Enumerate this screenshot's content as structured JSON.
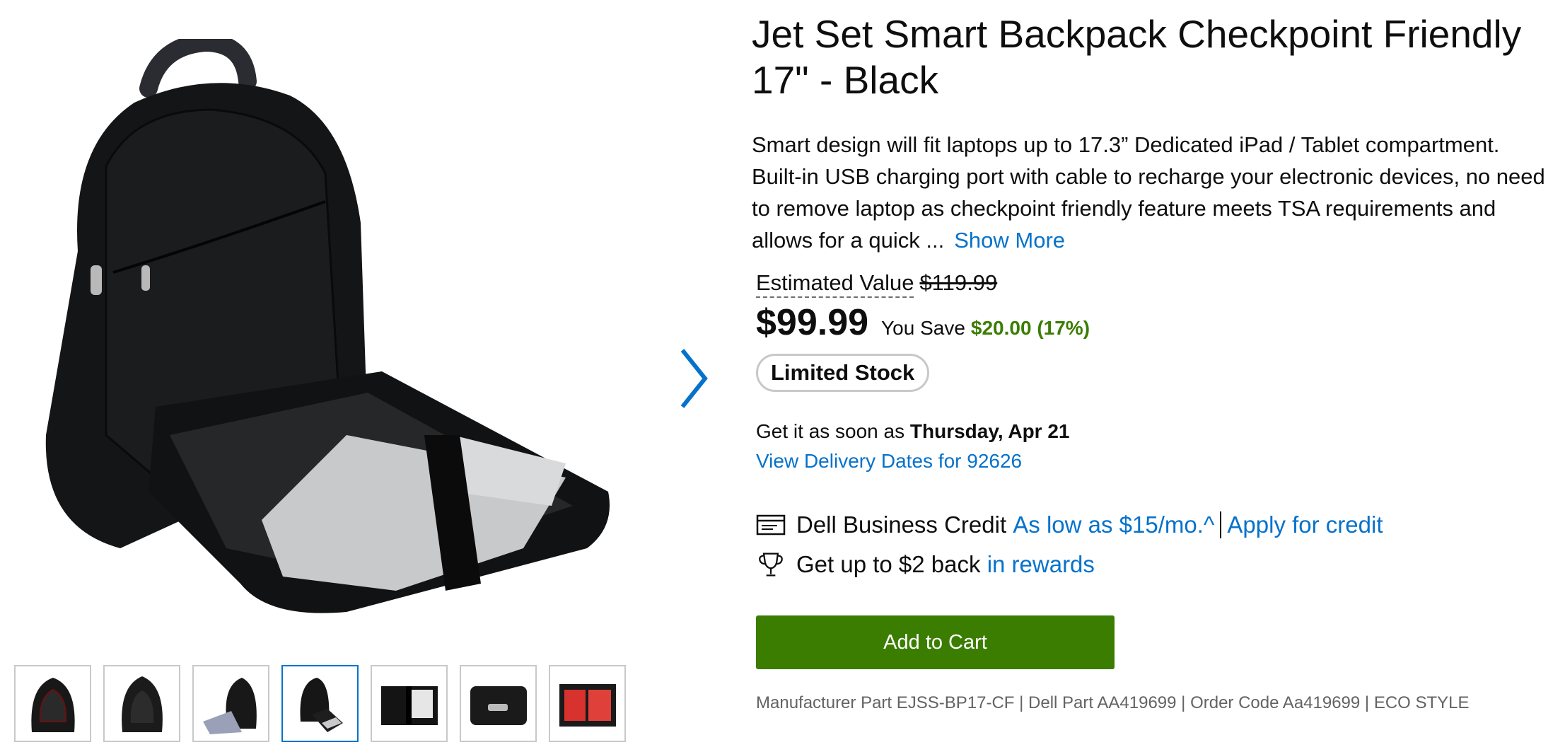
{
  "product": {
    "title": "Jet Set Smart Backpack Checkpoint Friendly 17\" - Black",
    "description": "Smart design will fit laptops up to 17.3” Dedicated iPad / Tablet compartment. Built-in USB charging port with cable to recharge your electronic devices, no need to remove laptop as checkpoint friendly feature meets TSA requirements and allows for a quick ...",
    "show_more_label": "Show More"
  },
  "pricing": {
    "estimated_label": "Estimated Value",
    "original_price": "$119.99",
    "price": "$99.99",
    "you_save_label": "You Save",
    "savings": "$20.00 (17%)",
    "savings_color": "#3a7d00"
  },
  "stock": {
    "badge": "Limited Stock"
  },
  "delivery": {
    "prefix": "Get it as soon as",
    "date": "Thursday, Apr 21",
    "link": "View Delivery Dates for 92626"
  },
  "financing": {
    "label": "Dell Business Credit",
    "rate_link": "As low as $15/mo.^",
    "apply_link": "Apply for credit",
    "icon": "credit-card-icon"
  },
  "rewards": {
    "prefix": "Get up to $2 back",
    "link": "in rewards",
    "icon": "trophy-icon"
  },
  "cart": {
    "button_label": "Add to Cart",
    "button_color": "#3a7d00"
  },
  "parts": {
    "text": "Manufacturer Part EJSS-BP17-CF | Dell Part AA419699 | Order Code Aa419699 | ECO STYLE"
  },
  "gallery": {
    "thumbnail_count": 7,
    "active_thumbnail": 4,
    "next_icon": "chevron-right-icon"
  },
  "colors": {
    "link": "#0672cb",
    "accent": "#3a7d00"
  }
}
